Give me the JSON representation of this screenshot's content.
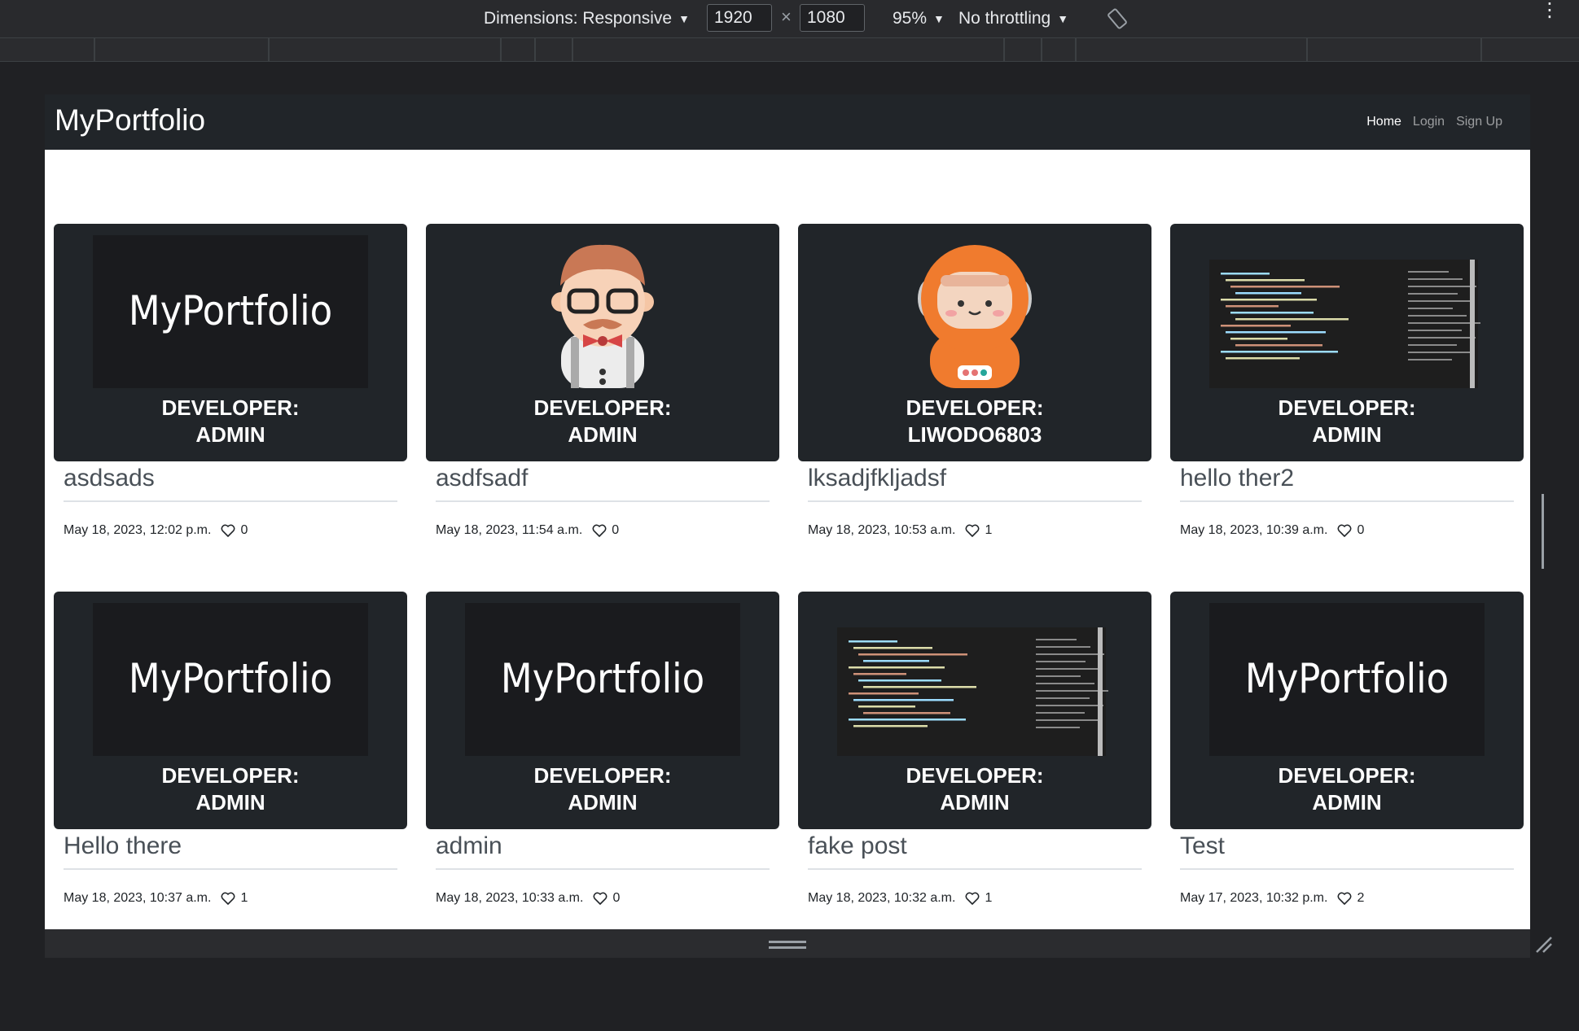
{
  "devtools": {
    "dimensions_label": "Dimensions: Responsive",
    "width_value": "1920",
    "height_value": "1080",
    "times": "×",
    "zoom_label": "95%",
    "throttle_label": "No throttling",
    "more": "⋮"
  },
  "site": {
    "brand": "MyPortfolio",
    "nav": {
      "home": "Home",
      "login": "Login",
      "signup": "Sign Up"
    }
  },
  "logo_text": "MyPortfolio",
  "posts": [
    {
      "dev_label": "DEVELOPER:",
      "dev_name": "ADMIN",
      "title": "asdsads",
      "date": "May 18, 2023, 12:02 p.m.",
      "likes": "0",
      "image": "logo"
    },
    {
      "dev_label": "DEVELOPER:",
      "dev_name": "ADMIN",
      "title": "asdfsadf",
      "date": "May 18, 2023, 11:54 a.m.",
      "likes": "0",
      "image": "avatar-man"
    },
    {
      "dev_label": "DEVELOPER:",
      "dev_name": "LIWODO6803",
      "title": "lksadjfkljadsf",
      "date": "May 18, 2023, 10:53 a.m.",
      "likes": "1",
      "image": "avatar-astronaut"
    },
    {
      "dev_label": "DEVELOPER:",
      "dev_name": "ADMIN",
      "title": "hello ther2",
      "date": "May 18, 2023, 10:39 a.m.",
      "likes": "0",
      "image": "code-screenshot"
    },
    {
      "dev_label": "DEVELOPER:",
      "dev_name": "ADMIN",
      "title": "Hello there",
      "date": "May 18, 2023, 10:37 a.m.",
      "likes": "1",
      "image": "logo"
    },
    {
      "dev_label": "DEVELOPER:",
      "dev_name": "ADMIN",
      "title": "admin",
      "date": "May 18, 2023, 10:33 a.m.",
      "likes": "0",
      "image": "logo"
    },
    {
      "dev_label": "DEVELOPER:",
      "dev_name": "ADMIN",
      "title": "fake post",
      "date": "May 18, 2023, 10:32 a.m.",
      "likes": "1",
      "image": "code-screenshot"
    },
    {
      "dev_label": "DEVELOPER:",
      "dev_name": "ADMIN",
      "title": "Test",
      "date": "May 17, 2023, 10:32 p.m.",
      "likes": "2",
      "image": "logo"
    }
  ]
}
